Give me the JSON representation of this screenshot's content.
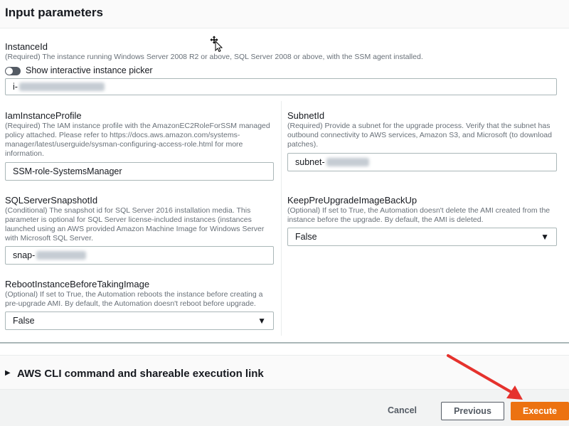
{
  "section": {
    "title": "Input parameters"
  },
  "instance_id": {
    "label": "InstanceId",
    "description": "(Required) The instance running Windows Server 2008 R2 or above, SQL Server 2008 or above, with the SSM agent installed.",
    "value_prefix": "i-"
  },
  "instance_picker_toggle": {
    "label": "Show interactive instance picker",
    "enabled": false
  },
  "iam_instance_profile": {
    "label": "IamInstanceProfile",
    "description": "(Required) The IAM instance profile with the AmazonEC2RoleForSSM managed policy attached. Please refer to https://docs.aws.amazon.com/systems-manager/latest/userguide/sysman-configuring-access-role.html for more information.",
    "value": "SSM-role-SystemsManager"
  },
  "subnet_id": {
    "label": "SubnetId",
    "description": "(Required) Provide a subnet for the upgrade process. Verify that the subnet has outbound connectivity to AWS services, Amazon S3, and Microsoft (to download patches).",
    "value_prefix": "subnet-"
  },
  "sql_server_snapshot_id": {
    "label": "SQLServerSnapshotId",
    "description": "(Conditional) The snapshot id for SQL Server 2016 installation media. This parameter is optional for SQL Server license-included instances (instances launched using an AWS provided Amazon Machine Image for Windows Server with Microsoft SQL Server.",
    "value_prefix": "snap-"
  },
  "keep_pre_upgrade_image_backup": {
    "label": "KeepPreUpgradeImageBackUp",
    "description": "(Optional) If set to True, the Automation doesn't delete the AMI created from the instance before the upgrade. By default, the AMI is deleted.",
    "selected": "False"
  },
  "reboot_instance_before_taking_image": {
    "label": "RebootInstanceBeforeTakingImage",
    "description": "(Optional) If set to True, the Automation reboots the instance before creating a pre-upgrade AMI. By default, the Automation doesn't reboot before upgrade.",
    "selected": "False"
  },
  "cli_section": {
    "title": "AWS CLI command and shareable execution link"
  },
  "footer": {
    "cancel_label": "Cancel",
    "previous_label": "Previous",
    "execute_label": "Execute"
  },
  "colors": {
    "primary": "#ec7211",
    "annotation_arrow": "#e5322d",
    "text": "#16191f",
    "muted_text": "#687078",
    "border": "#aab7b8"
  },
  "icons": {
    "move_cursor": "move-cursor-icon",
    "dropdown": "caret-down-icon",
    "expand": "caret-right-icon",
    "annotation": "red-arrow-annotation"
  }
}
